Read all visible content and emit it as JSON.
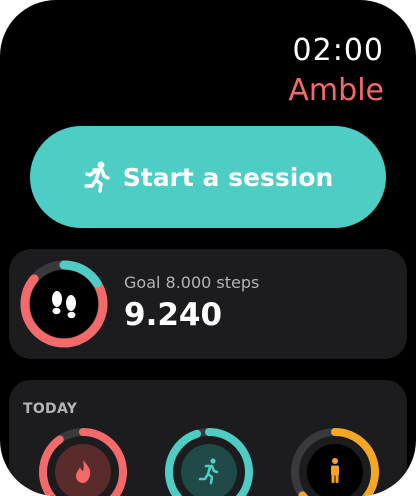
{
  "status": {
    "time": "02:00",
    "app_name": "Amble"
  },
  "start_button": {
    "label": "Start a session",
    "icon": "running-person-icon"
  },
  "goal": {
    "label": "Goal 8.000 steps",
    "value": "9.240",
    "icon": "footprints-icon",
    "progress_fraction": 0.86,
    "overflow_fraction": 0.16,
    "ring_color": "#f46a6a",
    "overflow_color": "#4ecdc4"
  },
  "today": {
    "label": "TODAY",
    "rings": [
      {
        "icon": "flame-icon",
        "color": "#f46a6a",
        "progress_fraction": 0.9
      },
      {
        "icon": "running-person-icon",
        "color": "#4ecdc4",
        "progress_fraction": 0.95
      },
      {
        "icon": "standing-person-icon",
        "color": "#f5a623",
        "progress_fraction": 0.65
      }
    ]
  }
}
